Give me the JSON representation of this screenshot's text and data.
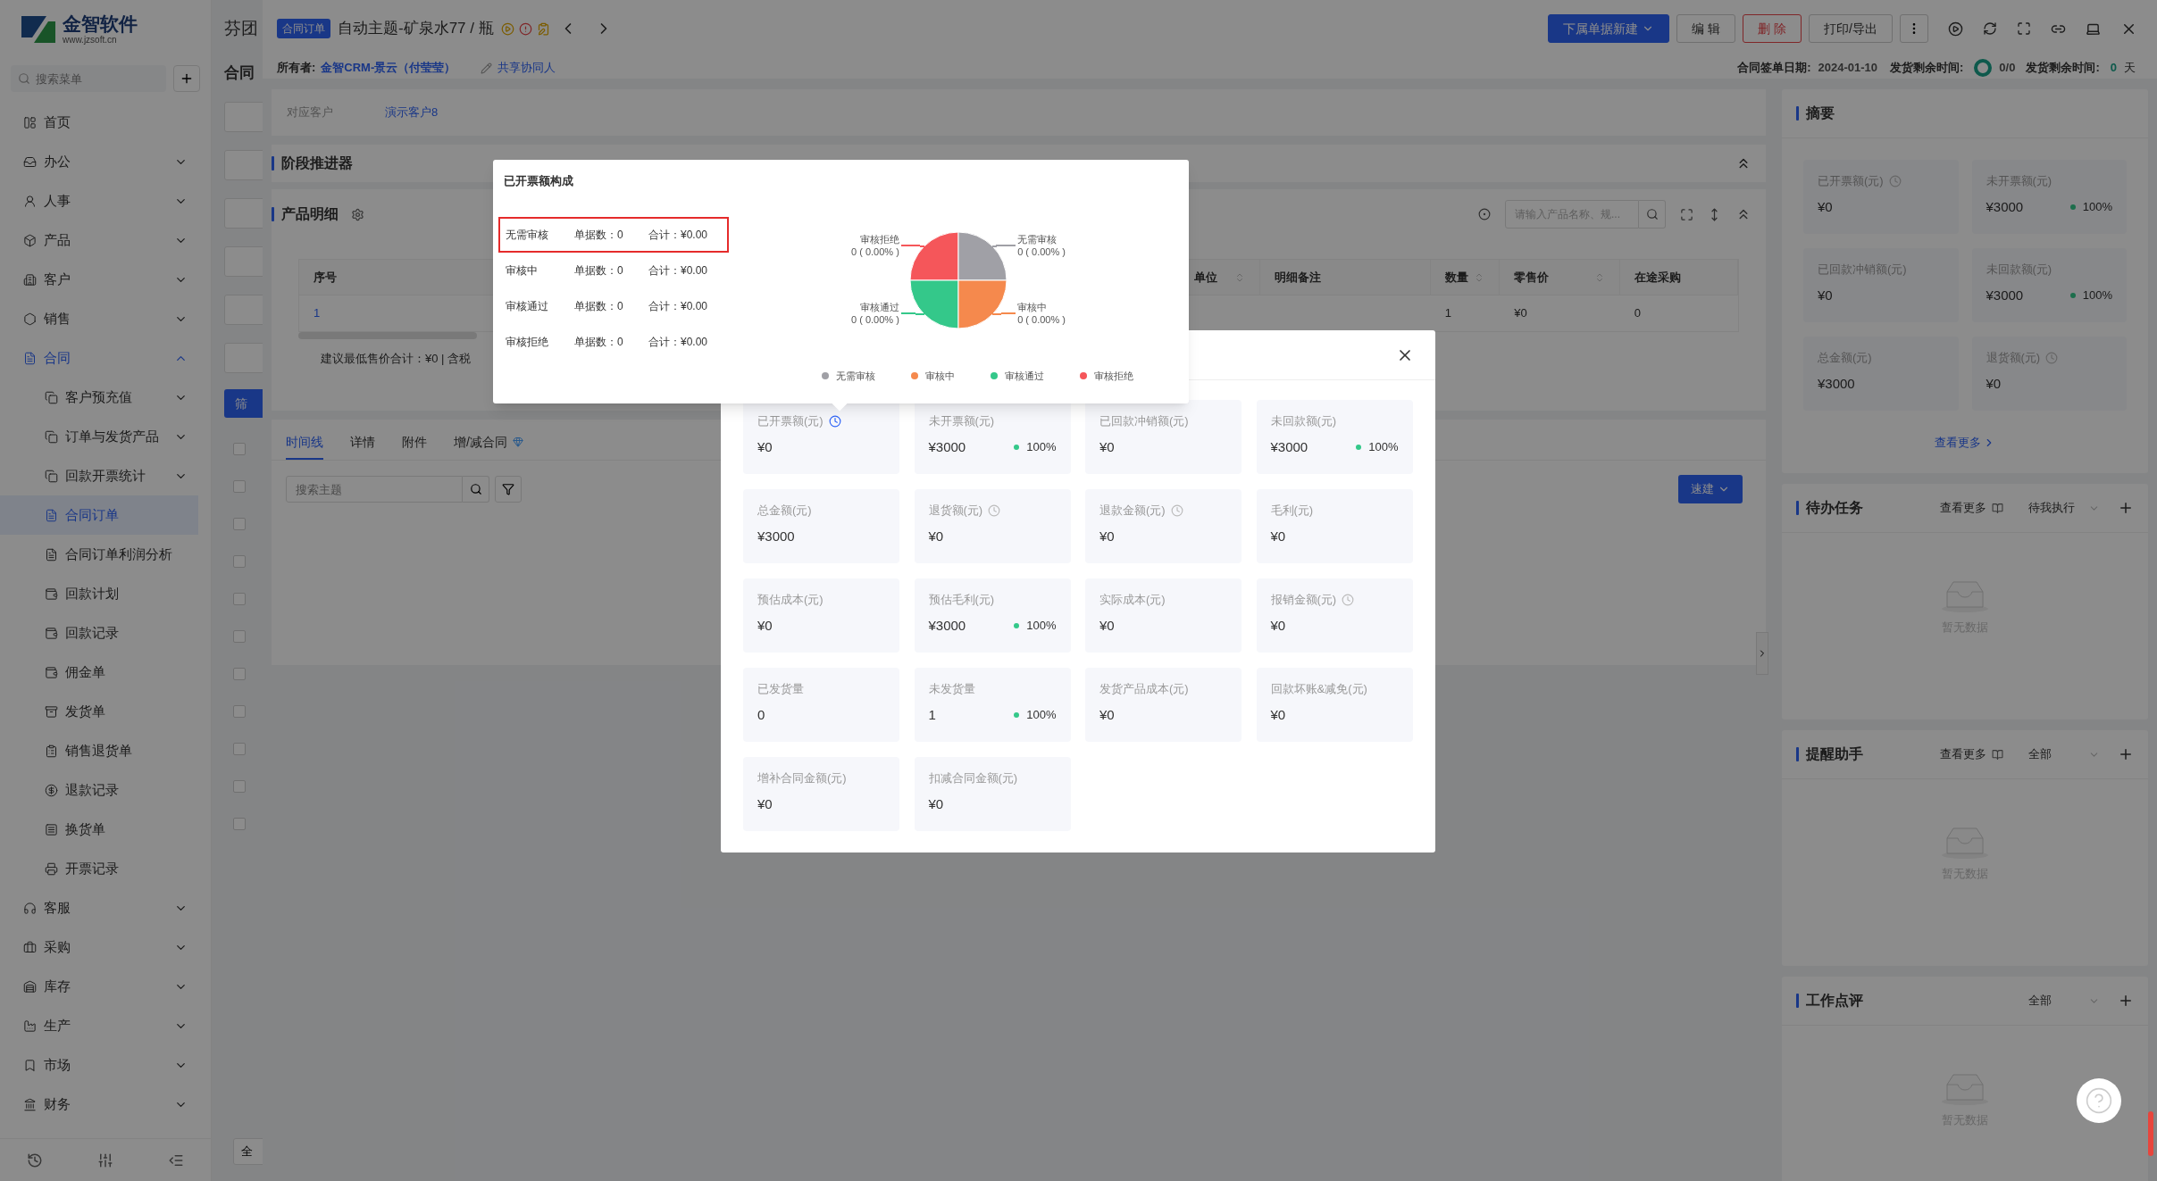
{
  "sidebar": {
    "logo": {
      "name": "金智软件",
      "url": "www.jzsoft.cn"
    },
    "search": {
      "placeholder": "搜索菜单"
    },
    "items": [
      {
        "label": "首页",
        "kind": "page",
        "selected": false
      },
      {
        "label": "办公",
        "kind": "group",
        "expanded": false,
        "selected": false
      },
      {
        "label": "人事",
        "kind": "group",
        "expanded": false,
        "selected": false
      },
      {
        "label": "产品",
        "kind": "group",
        "expanded": false,
        "selected": false
      },
      {
        "label": "客户",
        "kind": "group",
        "expanded": false,
        "selected": false
      },
      {
        "label": "销售",
        "kind": "group",
        "expanded": false,
        "selected": false
      },
      {
        "label": "合同",
        "kind": "group",
        "expanded": true,
        "selected": false,
        "children": [
          {
            "label": "客户预充值",
            "kind": "group",
            "expanded": false,
            "selected": false
          },
          {
            "label": "订单与发货产品",
            "kind": "group",
            "expanded": false,
            "selected": false
          },
          {
            "label": "回款开票统计",
            "kind": "group",
            "expanded": false,
            "selected": false
          },
          {
            "label": "合同订单",
            "kind": "page",
            "selected": true
          },
          {
            "label": "合同订单利润分析",
            "kind": "page",
            "selected": false
          },
          {
            "label": "回款计划",
            "kind": "page",
            "selected": false
          },
          {
            "label": "回款记录",
            "kind": "page",
            "selected": false
          },
          {
            "label": "佣金单",
            "kind": "page",
            "selected": false
          },
          {
            "label": "发货单",
            "kind": "page",
            "selected": false
          },
          {
            "label": "销售退货单",
            "kind": "page",
            "selected": false
          },
          {
            "label": "退款记录",
            "kind": "page",
            "selected": false
          },
          {
            "label": "换货单",
            "kind": "page",
            "selected": false
          },
          {
            "label": "开票记录",
            "kind": "page",
            "selected": false
          }
        ]
      },
      {
        "label": "客服",
        "kind": "group",
        "expanded": false,
        "selected": false
      },
      {
        "label": "采购",
        "kind": "group",
        "expanded": false,
        "selected": false
      },
      {
        "label": "库存",
        "kind": "group",
        "expanded": false,
        "selected": false
      },
      {
        "label": "生产",
        "kind": "group",
        "expanded": false,
        "selected": false
      },
      {
        "label": "市场",
        "kind": "group",
        "expanded": false,
        "selected": false
      },
      {
        "label": "财务",
        "kind": "group",
        "expanded": false,
        "selected": false
      }
    ]
  },
  "list_page": {
    "title": "芬团",
    "subtitle": "合同",
    "filter_button": "筛",
    "footer_text": "全",
    "rows": [
      {
        "checked": false
      },
      {
        "checked": false
      },
      {
        "checked": false
      },
      {
        "checked": false
      },
      {
        "checked": false
      },
      {
        "checked": false
      },
      {
        "checked": false
      },
      {
        "checked": false
      },
      {
        "checked": false
      },
      {
        "checked": false
      },
      {
        "checked": false
      }
    ]
  },
  "drawer": {
    "header": {
      "tag": "合同订单",
      "title": "自动主题-矿泉水77 / 瓶",
      "owner_label": "所有者:",
      "owner": "金智CRM-景云（付莹莹）",
      "share": "共享协同人",
      "buttons": [
        {
          "label": "下属单据新建",
          "kind": "primary"
        },
        {
          "label": "编 辑",
          "kind": "default"
        },
        {
          "label": "删 除",
          "kind": "danger"
        },
        {
          "label": "打印/导出",
          "kind": "default"
        }
      ],
      "sign_date": {
        "label": "合同签单日期:",
        "value": "2024-01-10"
      },
      "delivery_progress": {
        "label": "发货剩余时间:",
        "value": "0/0"
      },
      "delivery_remaining": {
        "label": "发货剩余时间:",
        "value": "0",
        "unit": "天"
      }
    },
    "customer": {
      "label": "对应客户",
      "value": "演示客户8"
    },
    "stage": {
      "title": "阶段推进器"
    },
    "products": {
      "title": "产品明细",
      "search_placeholder": "请输入产品名称、规...",
      "columns": [
        {
          "label": "序号",
          "sortable": false
        },
        {
          "label": "单位",
          "sortable": true
        },
        {
          "label": "明细备注",
          "sortable": false
        },
        {
          "label": "数量",
          "sortable": true
        },
        {
          "label": "零售价",
          "sortable": true
        },
        {
          "label": "在途采购",
          "sortable": false
        }
      ],
      "rows": [
        {
          "index": "1",
          "quantity": "1",
          "retail_price": "¥0",
          "in_transit": "0"
        }
      ],
      "footer_text": "建议最低售价合计：¥0 | 含税"
    },
    "tabs": [
      {
        "label": "时间线",
        "selected": true
      },
      {
        "label": "详情",
        "selected": false
      },
      {
        "label": "附件",
        "selected": false
      },
      {
        "label": "增/减合同",
        "selected": false
      }
    ],
    "timeline": {
      "search_placeholder": "搜索主题",
      "quick_button": "速建"
    },
    "summary": {
      "title": "摘要",
      "more": "查看更多",
      "stats": [
        {
          "label": "已开票额(元)",
          "value": "¥0",
          "clock": true,
          "clock_active": false
        },
        {
          "label": "未开票额(元)",
          "value": "¥3000",
          "percent": "100%",
          "clock": false
        },
        {
          "label": "已回款冲销额(元)",
          "value": "¥0",
          "clock": false
        },
        {
          "label": "未回款额(元)",
          "value": "¥3000",
          "percent": "100%",
          "clock": false
        },
        {
          "label": "总金额(元)",
          "value": "¥3000",
          "clock": false
        },
        {
          "label": "退货额(元)",
          "value": "¥0",
          "clock": true,
          "clock_active": false
        }
      ]
    },
    "panels": [
      {
        "title": "待办任务",
        "more": "查看更多",
        "filter": "待我执行",
        "empty": "暂无数据"
      },
      {
        "title": "提醒助手",
        "more": "查看更多",
        "filter": "全部",
        "empty": "暂无数据"
      },
      {
        "title": "工作点评",
        "filter": "全部",
        "empty": "暂无数据"
      }
    ]
  },
  "modal": {
    "cards": [
      {
        "label": "已开票额(元)",
        "value": "¥0",
        "clock": true,
        "clock_active": true
      },
      {
        "label": "未开票额(元)",
        "value": "¥3000",
        "percent": "100%",
        "clock": false
      },
      {
        "label": "已回款冲销额(元)",
        "value": "¥0",
        "clock": false
      },
      {
        "label": "未回款额(元)",
        "value": "¥3000",
        "percent": "100%",
        "clock": false
      },
      {
        "label": "总金额(元)",
        "value": "¥3000",
        "clock": false
      },
      {
        "label": "退货额(元)",
        "value": "¥0",
        "clock": true,
        "clock_active": false
      },
      {
        "label": "退款金额(元)",
        "value": "¥0",
        "clock": true,
        "clock_active": false
      },
      {
        "label": "毛利(元)",
        "value": "¥0",
        "clock": false
      },
      {
        "label": "预估成本(元)",
        "value": "¥0",
        "clock": false
      },
      {
        "label": "预估毛利(元)",
        "value": "¥3000",
        "percent": "100%",
        "clock": false
      },
      {
        "label": "实际成本(元)",
        "value": "¥0",
        "clock": false
      },
      {
        "label": "报销金额(元)",
        "value": "¥0",
        "clock": true,
        "clock_active": false
      },
      {
        "label": "已发货量",
        "value": "0",
        "clock": false
      },
      {
        "label": "未发货量",
        "value": "1",
        "percent": "100%",
        "clock": false
      },
      {
        "label": "发货产品成本(元)",
        "value": "¥0",
        "clock": false
      },
      {
        "label": "回款坏账&减免(元)",
        "value": "¥0",
        "clock": false
      },
      {
        "label": "增补合同金额(元)",
        "value": "¥0",
        "clock": false
      },
      {
        "label": "扣减合同金额(元)",
        "value": "¥0",
        "clock": false
      }
    ]
  },
  "popover": {
    "title": "已开票额构成",
    "rows": [
      {
        "status": "无需审核",
        "count": "单据数：0",
        "total": "合计：¥0.00",
        "selected": true
      },
      {
        "status": "审核中",
        "count": "单据数：0",
        "total": "合计：¥0.00",
        "selected": false
      },
      {
        "status": "审核通过",
        "count": "单据数：0",
        "total": "合计：¥0.00",
        "selected": false
      },
      {
        "status": "审核拒绝",
        "count": "单据数：0",
        "total": "合计：¥0.00",
        "selected": false
      }
    ],
    "slices": [
      {
        "label": "审核拒绝",
        "value": "0 ( 0.00% )",
        "color": "#f5565a"
      },
      {
        "label": "无需审核",
        "value": "0 ( 0.00% )",
        "color": "#a0a0a6"
      },
      {
        "label": "审核通过",
        "value": "0 ( 0.00% )",
        "color": "#34c88a"
      },
      {
        "label": "审核中",
        "value": "0 ( 0.00% )",
        "color": "#f5894d"
      }
    ],
    "legend": [
      {
        "label": "无需审核",
        "color": "#a0a0a6"
      },
      {
        "label": "审核中",
        "color": "#f5894d"
      },
      {
        "label": "审核通过",
        "color": "#34c88a"
      },
      {
        "label": "审核拒绝",
        "color": "#f5565a"
      }
    ]
  }
}
